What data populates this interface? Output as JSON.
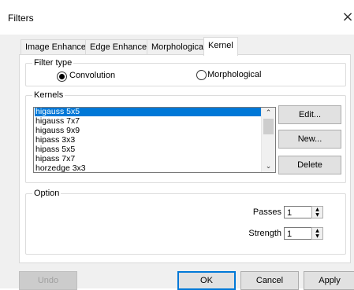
{
  "window": {
    "title": "Filters",
    "close_glyph": "×"
  },
  "tabs": [
    {
      "label": "Image Enhance",
      "active": false
    },
    {
      "label": "Edge Enhance",
      "active": false
    },
    {
      "label": "Morphological",
      "active": false
    },
    {
      "label": "Kernel",
      "active": true
    }
  ],
  "filter_type": {
    "group_label": "Filter type",
    "options": [
      {
        "label": "Convolution",
        "selected": true
      },
      {
        "label": "Morphological",
        "selected": false
      }
    ]
  },
  "kernels": {
    "group_label": "Kernels",
    "items": [
      "higauss 5x5",
      "higauss 7x7",
      "higauss 9x9",
      "hipass 3x3",
      "hipass 5x5",
      "hipass 7x7",
      "horzedge 3x3"
    ],
    "selected_index": 0,
    "buttons": {
      "edit": "Edit...",
      "new": "New...",
      "delete": "Delete"
    }
  },
  "option": {
    "group_label": "Option",
    "passes_label": "Passes",
    "passes_value": "1",
    "strength_label": "Strength",
    "strength_value": "1"
  },
  "footer": {
    "undo": "Undo",
    "ok": "OK",
    "cancel": "Cancel",
    "apply": "Apply"
  },
  "icons": {
    "scroll_up": "chevron-up-icon",
    "scroll_down": "chevron-down-icon",
    "spin_up": "triangle-up-icon",
    "spin_down": "triangle-down-icon"
  },
  "colors": {
    "selection": "#0078d7",
    "dialog_bg": "#f0f0f0"
  }
}
